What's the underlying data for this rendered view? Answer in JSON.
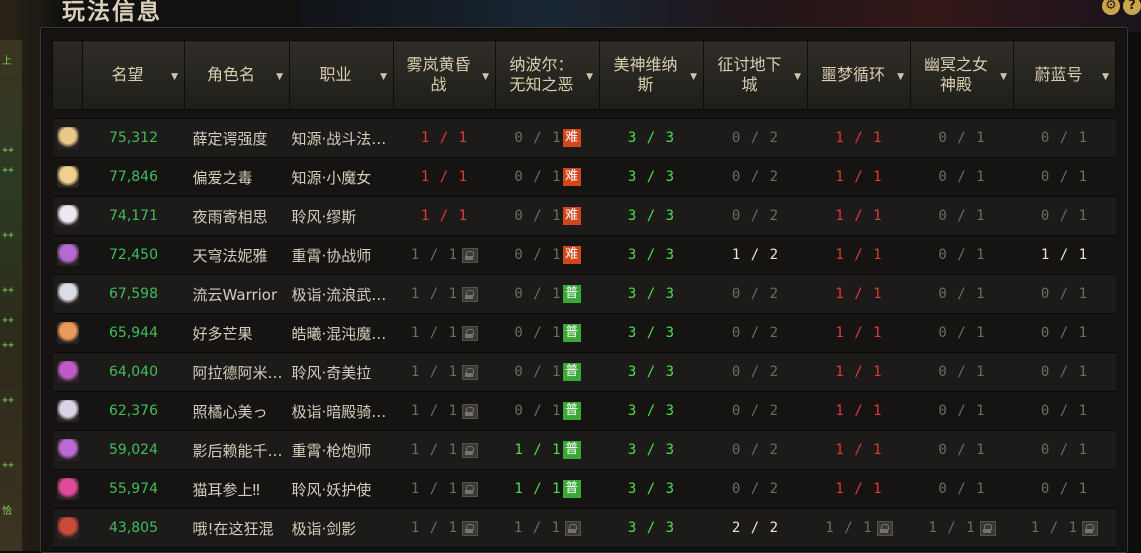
{
  "title": "玩法信息",
  "corner_icons": [
    {
      "name": "gear-icon",
      "glyph": "⚙"
    },
    {
      "name": "help-icon",
      "glyph": "?"
    }
  ],
  "left_strip_text": [
    "上",
    "++",
    "++",
    "++",
    "++",
    "++",
    "++",
    "++",
    "++",
    "恰"
  ],
  "columns": [
    {
      "label": "名望",
      "sortable": true
    },
    {
      "label": "角色名",
      "sortable": true
    },
    {
      "label": "职业",
      "sortable": true
    },
    {
      "label": "雾岚黄昏战",
      "sortable": true
    },
    {
      "label": "纳波尔：无知之恶",
      "sortable": true
    },
    {
      "label": "美神维纳斯",
      "sortable": true
    },
    {
      "label": "征讨地下城",
      "sortable": true
    },
    {
      "label": "噩梦循环",
      "sortable": true
    },
    {
      "label": "幽冥之女神殿",
      "sortable": true
    },
    {
      "label": "蔚蓝号",
      "sortable": true
    }
  ],
  "badges": {
    "hard": "难",
    "normal": "普"
  },
  "colors": {
    "red": "#e03a36",
    "green": "#49e04a",
    "white": "#ece6d2",
    "gray": "#6e6b64",
    "fame": "#3fbf5a"
  },
  "rows": [
    {
      "avatar": "#e8c98a",
      "fame": "75,312",
      "name": "薛定谔强度",
      "job": "知源·战斗法…",
      "cells": [
        {
          "v": "1 / 1",
          "c": "red"
        },
        {
          "v": "0 / 1",
          "c": "gray",
          "badge": "hard"
        },
        {
          "v": "3 / 3",
          "c": "green"
        },
        {
          "v": "0 / 2",
          "c": "gray"
        },
        {
          "v": "1 / 1",
          "c": "red"
        },
        {
          "v": "0 / 1",
          "c": "gray"
        },
        {
          "v": "0 / 1",
          "c": "gray"
        }
      ]
    },
    {
      "avatar": "#f0d08c",
      "fame": "77,846",
      "name": "偏爱之毒",
      "job": "知源·小魔女",
      "cells": [
        {
          "v": "1 / 1",
          "c": "red"
        },
        {
          "v": "0 / 1",
          "c": "gray",
          "badge": "hard"
        },
        {
          "v": "3 / 3",
          "c": "green"
        },
        {
          "v": "0 / 2",
          "c": "gray"
        },
        {
          "v": "1 / 1",
          "c": "red"
        },
        {
          "v": "0 / 1",
          "c": "gray"
        },
        {
          "v": "0 / 1",
          "c": "gray"
        }
      ]
    },
    {
      "avatar": "#eee6f0",
      "fame": "74,171",
      "name": "夜雨寄相思",
      "job": "聆风·缪斯",
      "cells": [
        {
          "v": "1 / 1",
          "c": "red"
        },
        {
          "v": "0 / 1",
          "c": "gray",
          "badge": "hard"
        },
        {
          "v": "3 / 3",
          "c": "green"
        },
        {
          "v": "0 / 2",
          "c": "gray"
        },
        {
          "v": "1 / 1",
          "c": "red"
        },
        {
          "v": "0 / 1",
          "c": "gray"
        },
        {
          "v": "0 / 1",
          "c": "gray"
        }
      ]
    },
    {
      "avatar": "#b46ad0",
      "fame": "72,450",
      "name": "天穹法妮雅",
      "job": "重霄·协战师",
      "cells": [
        {
          "v": "1 / 1",
          "c": "gray",
          "lock": true
        },
        {
          "v": "0 / 1",
          "c": "gray",
          "badge": "hard"
        },
        {
          "v": "3 / 3",
          "c": "green"
        },
        {
          "v": "1 / 2",
          "c": "white"
        },
        {
          "v": "1 / 1",
          "c": "red"
        },
        {
          "v": "0 / 1",
          "c": "gray"
        },
        {
          "v": "1 / 1",
          "c": "white"
        }
      ]
    },
    {
      "avatar": "#dcdce6",
      "fame": "67,598",
      "name": "流云Warrior",
      "job": "极诣·流浪武…",
      "cells": [
        {
          "v": "1 / 1",
          "c": "gray",
          "lock": true
        },
        {
          "v": "0 / 1",
          "c": "gray",
          "badge": "normal"
        },
        {
          "v": "3 / 3",
          "c": "green"
        },
        {
          "v": "0 / 2",
          "c": "gray"
        },
        {
          "v": "1 / 1",
          "c": "red"
        },
        {
          "v": "0 / 1",
          "c": "gray"
        },
        {
          "v": "0 / 1",
          "c": "gray"
        }
      ]
    },
    {
      "avatar": "#e89a5a",
      "fame": "65,944",
      "name": "好多芒果",
      "job": "皓曦·混沌魔…",
      "cells": [
        {
          "v": "1 / 1",
          "c": "gray",
          "lock": true
        },
        {
          "v": "0 / 1",
          "c": "gray",
          "badge": "normal"
        },
        {
          "v": "3 / 3",
          "c": "green"
        },
        {
          "v": "0 / 2",
          "c": "gray"
        },
        {
          "v": "1 / 1",
          "c": "red"
        },
        {
          "v": "0 / 1",
          "c": "gray"
        },
        {
          "v": "0 / 1",
          "c": "gray"
        }
      ]
    },
    {
      "avatar": "#c05ac8",
      "fame": "64,040",
      "name": "阿拉德阿米…",
      "job": "聆风·奇美拉",
      "cells": [
        {
          "v": "1 / 1",
          "c": "gray",
          "lock": true
        },
        {
          "v": "0 / 1",
          "c": "gray",
          "badge": "normal"
        },
        {
          "v": "3 / 3",
          "c": "green"
        },
        {
          "v": "0 / 2",
          "c": "gray"
        },
        {
          "v": "1 / 1",
          "c": "red"
        },
        {
          "v": "0 / 1",
          "c": "gray"
        },
        {
          "v": "0 / 1",
          "c": "gray"
        }
      ]
    },
    {
      "avatar": "#d8d4e6",
      "fame": "62,376",
      "name": "照橘心美っ",
      "job": "极诣·暗殿骑…",
      "cells": [
        {
          "v": "1 / 1",
          "c": "gray",
          "lock": true
        },
        {
          "v": "0 / 1",
          "c": "gray",
          "badge": "normal"
        },
        {
          "v": "3 / 3",
          "c": "green"
        },
        {
          "v": "0 / 2",
          "c": "gray"
        },
        {
          "v": "1 / 1",
          "c": "red"
        },
        {
          "v": "0 / 1",
          "c": "gray"
        },
        {
          "v": "0 / 1",
          "c": "gray"
        }
      ]
    },
    {
      "avatar": "#b86ad6",
      "fame": "59,024",
      "name": "影后赖能千…",
      "job": "重霄·枪炮师",
      "cells": [
        {
          "v": "1 / 1",
          "c": "gray",
          "lock": true
        },
        {
          "v": "1 / 1",
          "c": "green",
          "badge": "normal"
        },
        {
          "v": "3 / 3",
          "c": "green"
        },
        {
          "v": "0 / 2",
          "c": "gray"
        },
        {
          "v": "1 / 1",
          "c": "red"
        },
        {
          "v": "0 / 1",
          "c": "gray"
        },
        {
          "v": "0 / 1",
          "c": "gray"
        }
      ]
    },
    {
      "avatar": "#e04a9a",
      "fame": "55,974",
      "name": "猫耳参上‼",
      "job": "聆风·妖护使",
      "cells": [
        {
          "v": "1 / 1",
          "c": "gray",
          "lock": true
        },
        {
          "v": "1 / 1",
          "c": "green",
          "badge": "normal"
        },
        {
          "v": "3 / 3",
          "c": "green"
        },
        {
          "v": "0 / 2",
          "c": "gray"
        },
        {
          "v": "1 / 1",
          "c": "red"
        },
        {
          "v": "0 / 1",
          "c": "gray"
        },
        {
          "v": "0 / 1",
          "c": "gray"
        }
      ]
    },
    {
      "avatar": "#c84a3a",
      "fame": "43,805",
      "name": "哦!在这狂混",
      "job": "极诣·剑影",
      "cells": [
        {
          "v": "1 / 1",
          "c": "gray",
          "lock": true
        },
        {
          "v": "1 / 1",
          "c": "gray",
          "lock": true
        },
        {
          "v": "3 / 3",
          "c": "green"
        },
        {
          "v": "2 / 2",
          "c": "white"
        },
        {
          "v": "1 / 1",
          "c": "gray",
          "lock": true
        },
        {
          "v": "1 / 1",
          "c": "gray",
          "lock": true
        },
        {
          "v": "1 / 1",
          "c": "gray",
          "lock": true
        }
      ]
    }
  ]
}
